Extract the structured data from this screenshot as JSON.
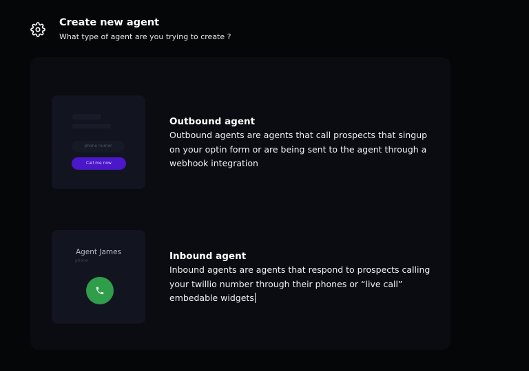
{
  "header": {
    "icon": "gear-icon",
    "title": "Create new agent",
    "subtitle": "What type of agent are you trying to create ?"
  },
  "options": [
    {
      "id": "outbound",
      "title": "Outbound agent",
      "description": "Outbound agents are agents that call prospects that singup on your optin form or are being sent to the agent through a webhook integration",
      "preview": {
        "input_placeholder": "phone numer",
        "button_label": "Call me now",
        "button_color": "#4a17c9"
      }
    },
    {
      "id": "inbound",
      "title": "Inbound agent",
      "description": "Inbound agents are agents that respond to prospects calling your twillio number through their phones or “live call” embedable widgets",
      "preview": {
        "agent_name": "Agent James",
        "agent_sub": "phone",
        "call_icon": "phone-icon",
        "call_color": "#2f9d4a"
      }
    }
  ]
}
